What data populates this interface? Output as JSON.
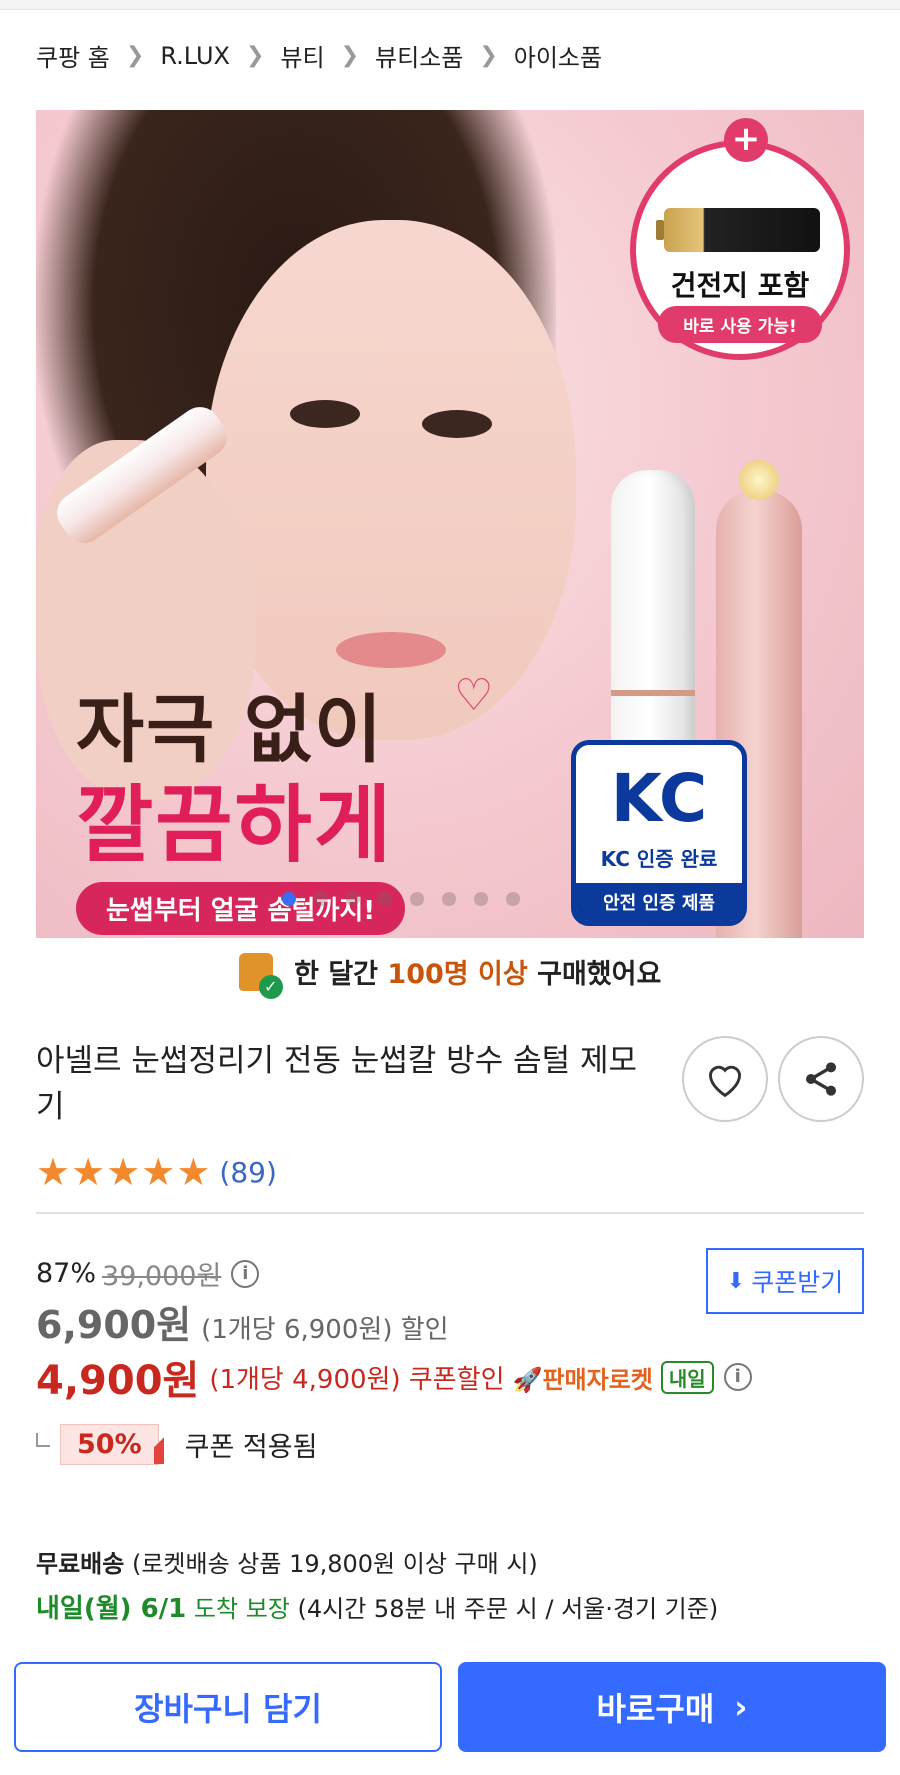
{
  "breadcrumb": [
    "쿠팡 홈",
    "R.LUX",
    "뷰티",
    "뷰티소품",
    "아이소품"
  ],
  "hero": {
    "badge_title": "건전지 포함",
    "badge_sub": "바로 사용 가능!",
    "headline1": "자극 없이",
    "headline2": "깔끔하게",
    "pill": "눈썹부터 얼굴 솜털까지!",
    "kc_mark": "KC",
    "kc_line1": "KC 인증 완료",
    "kc_line2": "안전 인증 제품"
  },
  "buyers": {
    "prefix": "한 달간",
    "highlight": "100명 이상",
    "suffix": "구매했어요"
  },
  "product": {
    "title": "아넬르 눈썹정리기 전동 눈썹칼 방수 솜털 제모기",
    "rating_count": "(89)",
    "rating": 5
  },
  "price": {
    "discount_pct": "87%",
    "original": "39,000원",
    "sale": "6,900원",
    "sale_note": "(1개당 6,900원) 할인",
    "coupon_price": "4,900원",
    "coupon_note": "(1개당 4,900원) 쿠폰할인",
    "rocket_label": "판매자로켓",
    "tomorrow_badge": "내일",
    "coupon_button": "쿠폰받기",
    "coupon_tag": "50%",
    "coupon_applied": "쿠폰 적용됨"
  },
  "shipping": {
    "free_label": "무료배송",
    "free_note": "(로켓배송 상품 19,800원 이상 구매 시)",
    "date": "내일(월) 6/1",
    "guarantee": "도착 보장",
    "note": "(4시간 58분 내 주문 시 / 서울·경기 기준)"
  },
  "actions": {
    "cart": "장바구니 담기",
    "buy": "바로구매"
  },
  "colors": {
    "accent": "#346aff",
    "price_red": "#c8281e",
    "rating_star": "#f2892c",
    "ship_green": "#1e8a2a"
  }
}
